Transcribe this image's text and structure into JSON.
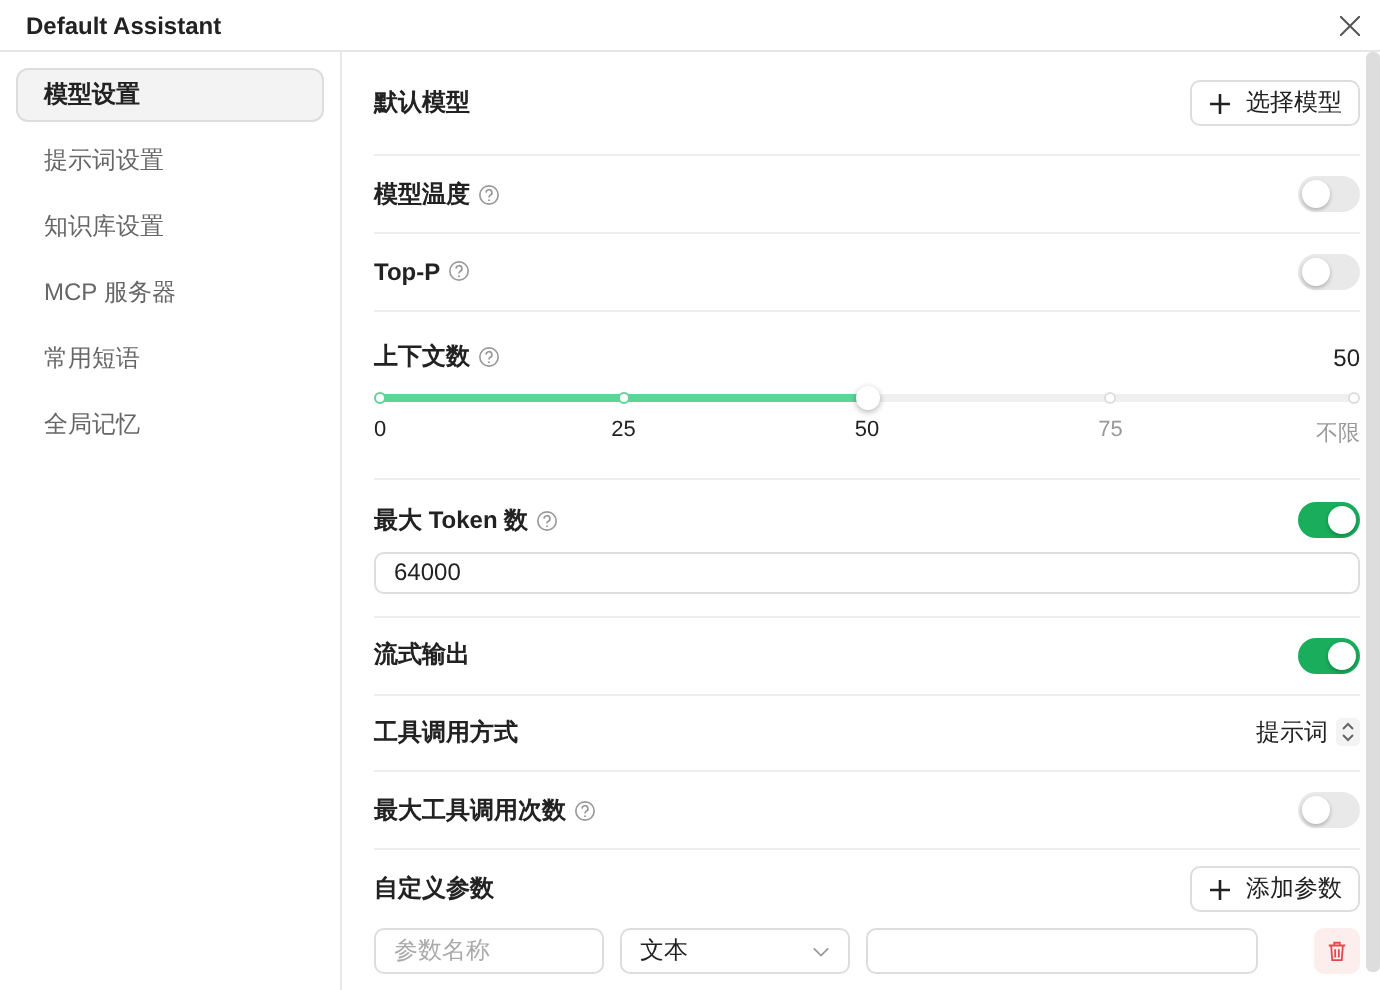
{
  "window": {
    "title": "Default Assistant"
  },
  "sidebar": {
    "items": [
      {
        "label": "模型设置",
        "selected": true
      },
      {
        "label": "提示词设置",
        "selected": false
      },
      {
        "label": "知识库设置",
        "selected": false
      },
      {
        "label": "MCP 服务器",
        "selected": false
      },
      {
        "label": "常用短语",
        "selected": false
      },
      {
        "label": "全局记忆",
        "selected": false
      }
    ]
  },
  "settings": [
    {
      "kind": "button",
      "label": "默认模型",
      "help": false,
      "button": "选择模型"
    },
    {
      "kind": "toggle",
      "label": "模型温度",
      "help": true,
      "on": false
    },
    {
      "kind": "toggle",
      "label": "Top-P",
      "help": true,
      "on": false
    },
    {
      "kind": "slider",
      "label": "上下文数",
      "help": true,
      "value": "50",
      "level": 0.5,
      "ticks": [
        "0",
        "25",
        "50",
        "75",
        "不限"
      ]
    },
    {
      "kind": "toggle",
      "label": "最大 Token 数",
      "help": true,
      "on": true,
      "value": "64000"
    },
    {
      "kind": "toggle",
      "label": "流式输出",
      "help": false,
      "on": true
    },
    {
      "kind": "select",
      "label": "工具调用方式",
      "help": false,
      "value": "提示词"
    },
    {
      "kind": "toggle",
      "label": "最大工具调用次数",
      "help": true,
      "on": false
    },
    {
      "kind": "params",
      "label": "自定义参数",
      "help": false,
      "button": "添加参数",
      "params": [
        {
          "name_placeholder": "参数名称",
          "type": "文本"
        }
      ]
    }
  ]
}
